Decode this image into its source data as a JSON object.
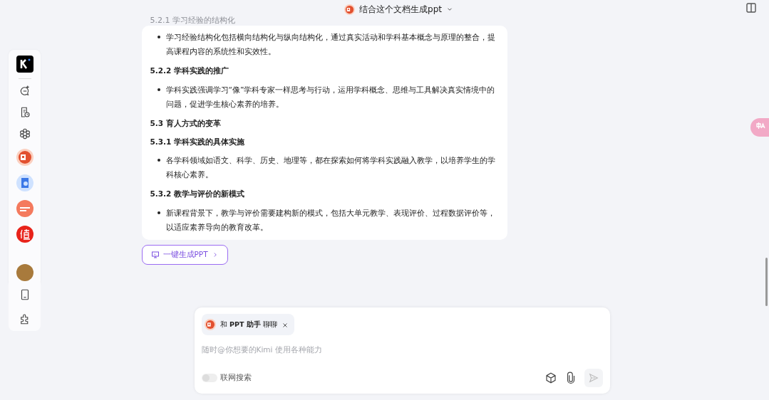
{
  "header": {
    "title": "结合这个文档生成ppt"
  },
  "message": {
    "faded_heading": "5.2.1 学习经验的结构化",
    "blocks": [
      {
        "kind": "bullet",
        "text": "学习经验结构化包括横向结构化与纵向结构化，通过真实活动和学科基本概念与原理的整合，提高课程内容的系统性和实效性。"
      },
      {
        "kind": "heading",
        "text": "5.2.2 学科实践的推广"
      },
      {
        "kind": "bullet",
        "text": "学科实践强调学习“像”学科专家一样思考与行动，运用学科概念、思维与工具解决真实情境中的问题，促进学生核心素养的培养。"
      },
      {
        "kind": "heading",
        "text": "5.3 育人方式的变革"
      },
      {
        "kind": "heading",
        "text": "5.3.1 学科实践的具体实施"
      },
      {
        "kind": "bullet",
        "text": "各学科领域如语文、科学、历史、地理等，都在探索如何将学科实践融入教学，以培养学生的学科核心素养。"
      },
      {
        "kind": "heading",
        "text": "5.3.2 教学与评价的新模式"
      },
      {
        "kind": "bullet",
        "text": "新课程背景下，教学与评价需要建构新的模式，包括大单元教学、表现评价、过程数据评价等，以适应素养导向的教育改革。"
      }
    ],
    "action": "一键生成PPT"
  },
  "sidebar": {
    "items": [
      {
        "kind": "new-chat"
      },
      {
        "kind": "history"
      },
      {
        "kind": "apps"
      },
      {
        "kind": "ppt"
      },
      {
        "kind": "doc"
      },
      {
        "kind": "prompt"
      },
      {
        "kind": "zhi"
      }
    ]
  },
  "composer": {
    "agent_prefix": "和",
    "agent_name": "PPT 助手",
    "agent_suffix": "聊聊",
    "placeholder": "随时@你想要的Kimi 使用各种能力",
    "web_search": {
      "label": "联网搜索",
      "on": false
    }
  }
}
